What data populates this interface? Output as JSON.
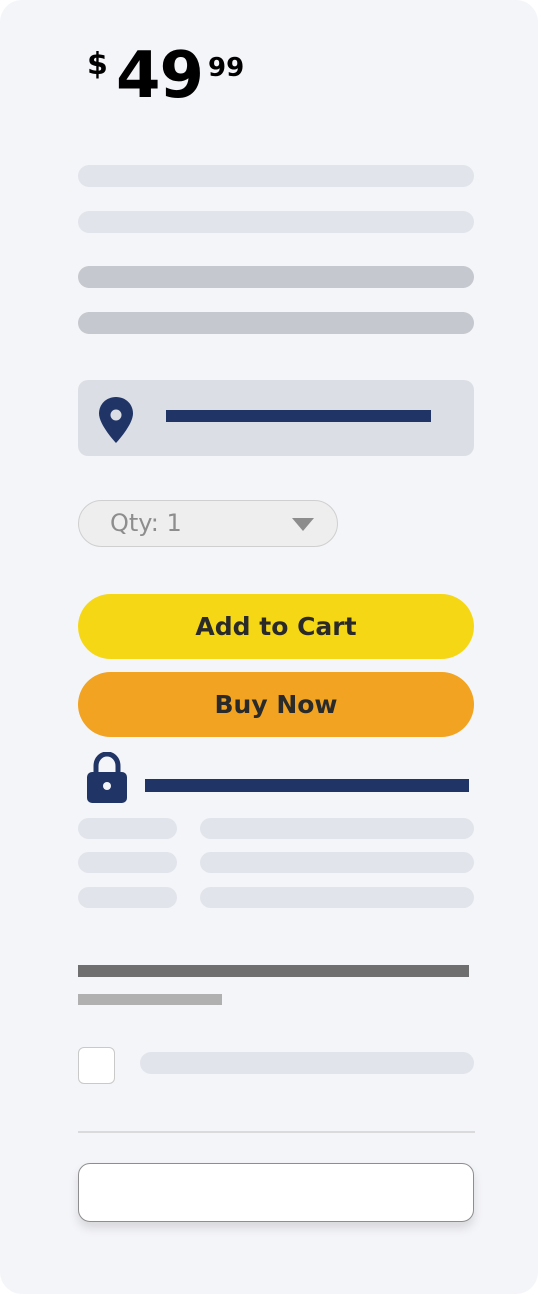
{
  "price": {
    "currency": "$",
    "dollars": "49",
    "cents": "99"
  },
  "quantity": {
    "label": "Qty: 1",
    "selected": 1
  },
  "buttons": {
    "add_to_cart": "Add to Cart",
    "buy_now": "Buy Now"
  },
  "icons": {
    "location": "map-pin-icon",
    "secure": "lock-icon",
    "quantity": "chevron-down-icon"
  },
  "colors": {
    "add_to_cart_bg": "#f5d716",
    "buy_now_bg": "#f1a321",
    "accent_navy": "#203566",
    "card_bg": "#f4f5f9"
  },
  "checkbox": {
    "checked": false
  },
  "text_input": {
    "value": "",
    "placeholder": ""
  }
}
